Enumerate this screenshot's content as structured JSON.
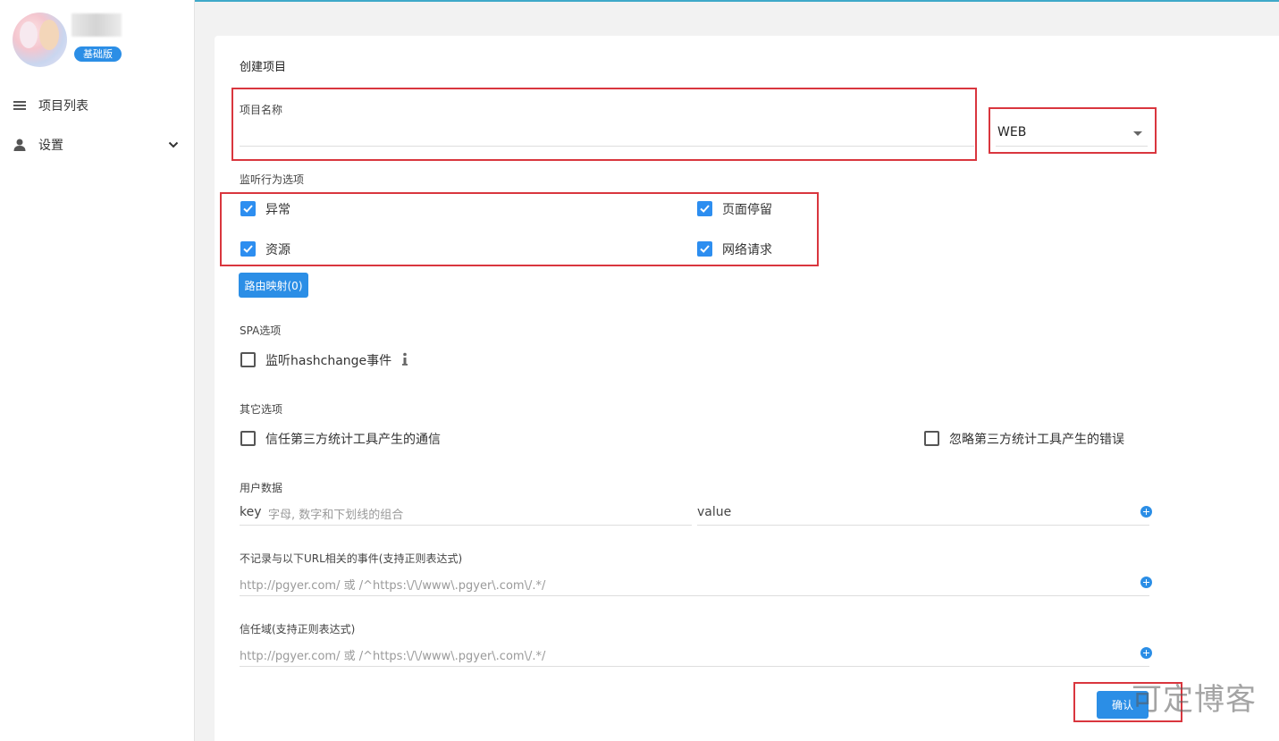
{
  "sidebar": {
    "plan_badge": "基础版",
    "items": [
      {
        "label": "项目列表",
        "icon": "list-icon"
      },
      {
        "label": "设置",
        "icon": "user-icon",
        "expand_icon": "chevron-down-icon"
      }
    ]
  },
  "form": {
    "title": "创建项目",
    "project_name": {
      "label": "项目名称",
      "value": ""
    },
    "platform_select": {
      "value": "WEB"
    },
    "monitor": {
      "label": "监听行为选项",
      "options": [
        {
          "label": "异常",
          "checked": true
        },
        {
          "label": "页面停留",
          "checked": true
        },
        {
          "label": "资源",
          "checked": true
        },
        {
          "label": "网络请求",
          "checked": true
        }
      ]
    },
    "route_button": "路由映射(0)",
    "spa": {
      "label": "SPA选项",
      "option": {
        "label": "监听hashchange事件",
        "checked": false
      },
      "info_icon": "info-icon"
    },
    "other": {
      "label": "其它选项",
      "options": [
        {
          "label": "信任第三方统计工具产生的通信",
          "checked": false
        },
        {
          "label": "忽略第三方统计工具产生的错误",
          "checked": false
        }
      ]
    },
    "user_data": {
      "label": "用户数据",
      "key_label": "key",
      "key_placeholder": "字母, 数字和下划线的组合",
      "value_label": "value"
    },
    "exclude_urls": {
      "label": "不记录与以下URL相关的事件(支持正则表达式)",
      "placeholder": "http://pgyer.com/ 或 /^https:\\/\\/www\\.pgyer\\.com\\/.*/"
    },
    "trusted_domains": {
      "label": "信任域(支持正则表达式)",
      "placeholder": "http://pgyer.com/ 或 /^https:\\/\\/www\\.pgyer\\.com\\/.*/"
    },
    "confirm_button": "确认"
  },
  "watermark": "可定博客",
  "colors": {
    "accent": "#2b8ee6",
    "annotation": "#d9363e"
  }
}
